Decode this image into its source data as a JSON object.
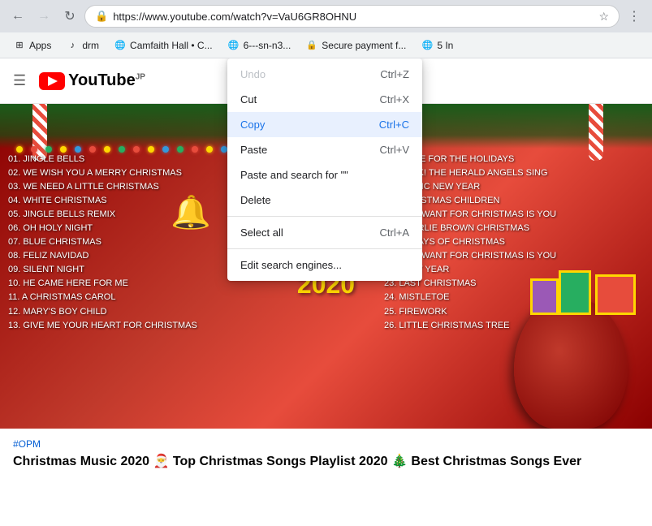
{
  "browser": {
    "url": "https://www.youtube.com/watch?v=VaU6GR8OHNU",
    "back_disabled": false,
    "forward_disabled": true
  },
  "bookmarks": [
    {
      "id": "apps",
      "label": "Apps",
      "icon": "⊞"
    },
    {
      "id": "drm",
      "label": "drm",
      "icon": "♪"
    },
    {
      "id": "camfaith",
      "label": "Camfaith Hall • C...",
      "icon": "🌐"
    },
    {
      "id": "b4",
      "label": "6---sn-n3...",
      "icon": ""
    },
    {
      "id": "b5",
      "label": "Secure payment f...",
      "icon": "🔒"
    },
    {
      "id": "b6",
      "label": "5 In",
      "icon": "🌐"
    }
  ],
  "youtube": {
    "logo_text": "YouTube",
    "logo_suffix": "JP"
  },
  "context_menu": {
    "items": [
      {
        "id": "undo",
        "label": "Undo",
        "shortcut": "Ctrl+Z",
        "disabled": true,
        "highlighted": false
      },
      {
        "id": "cut",
        "label": "Cut",
        "shortcut": "Ctrl+X",
        "disabled": false,
        "highlighted": false
      },
      {
        "id": "copy",
        "label": "Copy",
        "shortcut": "Ctrl+C",
        "disabled": false,
        "highlighted": true
      },
      {
        "id": "paste",
        "label": "Paste",
        "shortcut": "Ctrl+V",
        "disabled": false,
        "highlighted": false
      },
      {
        "id": "paste-search",
        "label": "Paste and search for  \"\"",
        "shortcut": "",
        "disabled": false,
        "highlighted": false
      },
      {
        "id": "delete",
        "label": "Delete",
        "shortcut": "",
        "disabled": false,
        "highlighted": false
      },
      {
        "id": "divider1",
        "type": "divider"
      },
      {
        "id": "select-all",
        "label": "Select all",
        "shortcut": "Ctrl+A",
        "disabled": false,
        "highlighted": false
      },
      {
        "id": "divider2",
        "type": "divider"
      },
      {
        "id": "edit-search",
        "label": "Edit search engines...",
        "shortcut": "",
        "disabled": false,
        "highlighted": false
      }
    ]
  },
  "video": {
    "hashtag": "#OPM",
    "title": "Christmas Music 2020 🎅 Top Christmas Songs Playlist 2020 🎄 Best Christmas Songs Ever",
    "songs_left": [
      "01. JINGLE BELLS",
      "02. WE WISH YOU A MERRY CHRISTMAS",
      "03. WE NEED A LITTLE CHRISTMAS",
      "04. WHITE CHRISTMAS",
      "05. JINGLE BELLS REMIX",
      "06. OH HOLY NIGHT",
      "07. BLUE CHRISTMAS",
      "08. FELIZ NAVIDAD",
      "09. SILENT NIGHT",
      "10. HE CAME HERE FOR ME",
      "11. A CHRISTMAS CAROL",
      "12. MARY'S BOY CHILD",
      "13. GIVE ME YOUR HEART FOR CHRISTMAS"
    ],
    "songs_right": [
      "14. HOME FOR THE HOLIDAYS",
      "15. HARK! THE HERALD ANGELS SING",
      "16. CELTIC NEW YEAR",
      "17. CHRISTMAS CHILDREN",
      "18. ALL I WANT FOR CHRISTMAS IS YOU",
      "19. CHARLIE BROWN CHRISTMAS",
      "20. 12 DAYS OF CHRISTMAS",
      "21. ALL I WANT FOR CHRISTMAS IS YOU",
      "22. NEXT YEAR",
      "23. LAST CHRISTMAS",
      "24. MISTLETOE",
      "25. FIREWORK",
      "26. LITTLE CHRISTMAS TREE"
    ]
  }
}
